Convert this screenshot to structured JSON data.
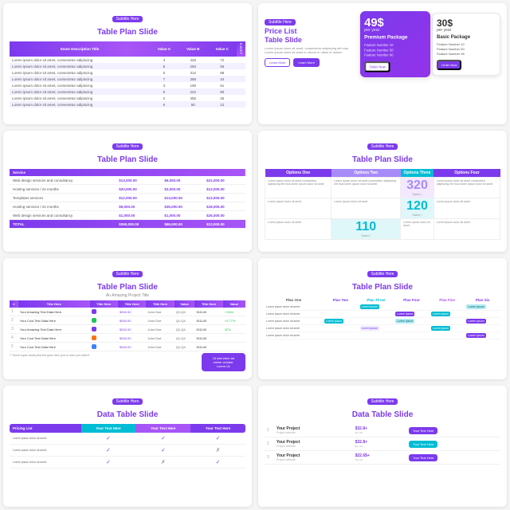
{
  "panels": [
    {
      "id": "p1",
      "badge": "Subtitle Here",
      "title": "Table Plan",
      "title_accent": "Slide",
      "table": {
        "headers": [
          "Some Description Title",
          "Value A",
          "Value B",
          "Value C"
        ],
        "rows": [
          [
            "Lorem ipsum dolor sit amet, consectetur adipiscing",
            "4",
            "425",
            "72"
          ],
          [
            "Lorem ipsum dolor sit amet, consectetur adipiscing",
            "8",
            "250",
            "56"
          ],
          [
            "Lorem ipsum dolor sit amet, consectetur adipiscing",
            "5",
            "312",
            "88"
          ],
          [
            "Lorem ipsum dolor sit amet, consectetur adipiscing",
            "7",
            "388",
            "34"
          ],
          [
            "Lorem ipsum dolor sit amet, consectetur adipiscing",
            "3",
            "199",
            "61"
          ],
          [
            "Lorem ipsum dolor sit amet, consectetur adipiscing",
            "9",
            "222",
            "80"
          ],
          [
            "Lorem ipsum dolor sit amet, consectetur adipiscing",
            "2",
            "355",
            "45"
          ],
          [
            "Lorem ipsum dolor sit amet, consectetur adipiscing",
            "6",
            "50",
            "12"
          ]
        ]
      }
    },
    {
      "id": "p2",
      "badge": "Subtitle Here",
      "title": "Price List",
      "title_accent": "Table Slide",
      "desc": "Lorem ipsum dolor sit amet, consectetur adipiscing elit mus. Lorem ipsum dolor sit amet in orturm in ullam et dolore.",
      "btn1": "Learn More",
      "btn2": "Learn More",
      "card1": {
        "price": "49$",
        "period": "per year",
        "name": "Premium Package",
        "features": [
          "Feature Number 10",
          "Feature Number 50",
          "Feature Number 90"
        ],
        "btn": "Order Now",
        "style": "purple"
      },
      "card2": {
        "price": "30$",
        "period": "per year",
        "name": "Basic Package",
        "features": [
          "Feature Number 10",
          "Feature Number 50",
          "Feature Number 96"
        ],
        "btn": "Order Now",
        "style": "light"
      }
    },
    {
      "id": "p3",
      "badge": "Subtitle Here",
      "title": "Table Plan",
      "title_accent": "Slide",
      "table": {
        "headers": [
          "",
          ""
        ],
        "rows": [
          [
            "Web design services and consultancy",
            "$13,000.00",
            "$6,000.00",
            "$21,000.00"
          ],
          [
            "Hosting services / 24 months",
            "$20,000.00",
            "$3,000.00",
            "$13,000.00"
          ],
          [
            "Templates services",
            "$12,000.00",
            "$13,000.00",
            "$13,000.00"
          ],
          [
            "Hosting services / 24 months",
            "$9,000.00",
            "$35,000.00",
            "$18,000.00"
          ],
          [
            "Web design services and consultancy",
            "$1,000.00",
            "$1,000.00",
            "$25,000.00"
          ]
        ],
        "total": [
          "TOTAL",
          "$350,000.00",
          "$86,000.00",
          "$13,000.00"
        ]
      }
    },
    {
      "id": "p4",
      "badge": "Subtitle Here",
      "title": "Table Plan",
      "title_accent": "Slide",
      "options": [
        "Options One",
        "Options Two",
        "Options Three",
        "Options Four"
      ],
      "big_numbers": [
        {
          "value": "320",
          "label": "Sales !"
        },
        {
          "value": "120",
          "label": "Sales !"
        },
        {
          "value": "110",
          "label": "Sales !"
        }
      ]
    },
    {
      "id": "p5",
      "badge": "Subtitle Here",
      "title": "Table Plan",
      "title_accent": "Slide",
      "subtitle": "An Amazing Project Title",
      "table": {
        "headers": [
          "#",
          "Title Here",
          "Title Here",
          "Title Here",
          "Title Here",
          "Value",
          "Title Here",
          "Value"
        ],
        "rows": [
          [
            "1",
            "Your Amazing Test Data Here",
            "purple",
            "$260.00",
            "John Doe",
            "Q1-Q4",
            "911140",
            "+1984"
          ],
          [
            "2",
            "Your Cool Test Data Here",
            "green",
            "$260.00",
            "John Doe",
            "Q1-Q4",
            "911140",
            "+0.77%"
          ],
          [
            "3",
            "Your Amazing Test Data Here",
            "purple",
            "$260.00",
            "John Doe",
            "Q1-Q4",
            "911140",
            "32%"
          ],
          [
            "4",
            "Your Cool Test Data Here",
            "orange",
            "$260.00",
            "John Doe",
            "Q1-Q4",
            "911140",
            ""
          ],
          [
            "5",
            "Your Cool Test Data Here",
            "blue",
            "$260.00",
            "John Doe",
            "Q1-Q4",
            "911140",
            ""
          ]
        ]
      },
      "note": "** Some super small print text goes here, just in case you need it",
      "side_box": {
        "line1": "Ut wisi enim ad",
        "line2": "minim veniam.",
        "line3": "Lorem Ut."
      }
    },
    {
      "id": "p6",
      "badge": "Subtitle Here",
      "title": "Table Plan",
      "title_accent": "Slide",
      "plans": [
        "Plan One",
        "Plan Two",
        "Plan Three",
        "Plan Four",
        "Plan Five",
        "Plan Six"
      ],
      "rows": [
        [
          "Lorem ipsum dolor sit amet",
          "",
          "Lorem ipsum",
          "",
          "",
          "Lorem ipsum"
        ],
        [
          "Lorem ipsum dolor sit amet",
          "",
          "",
          "Lorem ipsum",
          "Lorem ipsum",
          ""
        ],
        [
          "Lorem ipsum dolor sit amet",
          "Lorem ipsum",
          "",
          "Lorem ipsum",
          "",
          "Lorem ipsum"
        ],
        [
          "Lorem ipsum dolor sit amet",
          "",
          "Lorem ipsum",
          "",
          "Lorem ipsum",
          ""
        ],
        [
          "Lorem ipsum dolor sit amet",
          "",
          "",
          "",
          "",
          "Lorem ipsum"
        ]
      ]
    },
    {
      "id": "p7",
      "badge": "Subtitle Here",
      "title": "Data Table",
      "title_accent": "Slide",
      "table": {
        "headers": [
          "Pricing List",
          "Your Text Here",
          "Your Text Here",
          "Your Text Here"
        ],
        "rows": [
          [
            "Lorem ipsum dolor sit amet.",
            true,
            true,
            true
          ],
          [
            "Lorem ipsum dolor sit amet.",
            true,
            true,
            false
          ],
          [
            "Lorem ipsum dolor sit amet.",
            true,
            false,
            true
          ]
        ]
      }
    },
    {
      "id": "p8",
      "badge": "Subtitle Here",
      "title": "Data Table",
      "title_accent": "Slide",
      "rows": [
        {
          "num": "1",
          "name": "Your Project",
          "sub": "Project website",
          "price": "$32.8+",
          "location": "$1( US",
          "tag": "Your Text Here",
          "style": "purple"
        },
        {
          "num": "2",
          "name": "Your Project",
          "sub": "Project website",
          "price": "$32.8+",
          "location": "$1( US",
          "tag": "Your Text Here",
          "style": "teal"
        },
        {
          "num": "3",
          "name": "Your Project",
          "sub": "Project website",
          "price": "$22.6$+",
          "location": "$1( US",
          "tag": "Your Text Here",
          "style": "purple"
        }
      ]
    }
  ]
}
